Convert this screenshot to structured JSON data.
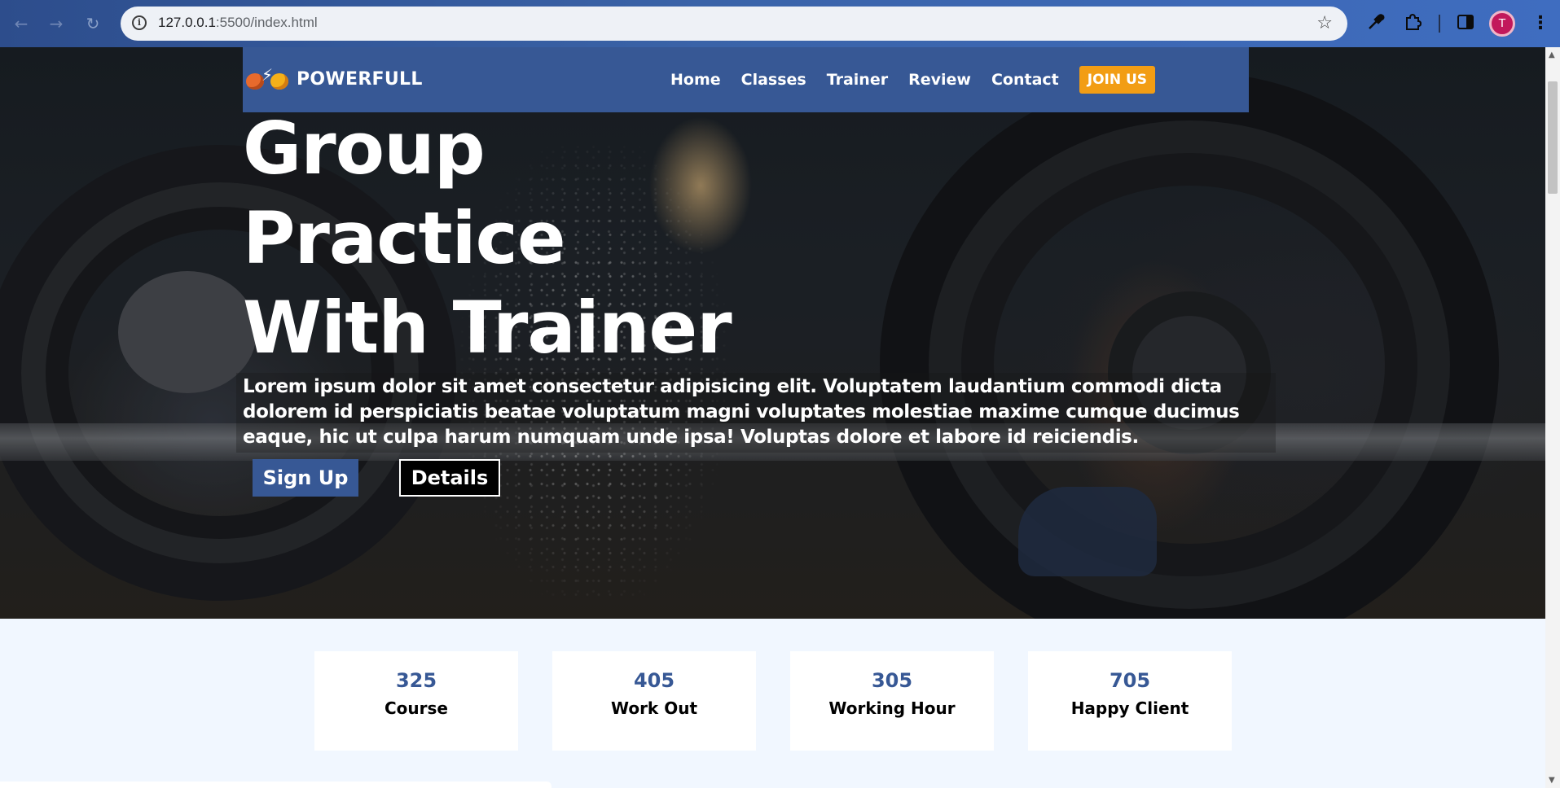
{
  "browser": {
    "url_host": "127.0.0.1",
    "url_rest": ":5500/index.html",
    "back_icon": "arrow-left",
    "forward_icon": "arrow-right",
    "reload_icon": "reload",
    "info_icon": "i",
    "bookmark_icon": "☆",
    "profile_initial": "T"
  },
  "site": {
    "logo_text": "POWERFULL",
    "nav": {
      "home": "Home",
      "classes": "Classes",
      "trainer": "Trainer",
      "review": "Review",
      "contact": "Contact",
      "join": "JOIN US"
    },
    "hero": {
      "title_line1": "Group",
      "title_line2": "Practice",
      "title_line3": "With Trainer",
      "text": "Lorem ipsum dolor sit amet consectetur adipisicing elit. Voluptatem laudantium commodi dicta dolorem id perspiciatis beatae voluptatum magni voluptates molestiae maxime cumque ducimus eaque, hic ut culpa harum numquam unde ipsa! Voluptas dolore et labore id reiciendis.",
      "signup": "Sign Up",
      "details": "Details"
    },
    "stats": [
      {
        "value": "325",
        "label": "Course"
      },
      {
        "value": "405",
        "label": "Work Out"
      },
      {
        "value": "305",
        "label": "Working Hour"
      },
      {
        "value": "705",
        "label": "Happy Client"
      }
    ]
  },
  "colors": {
    "brand_blue": "#375895",
    "accent_orange": "#f29d14",
    "stats_bg": "#f1f7ff"
  }
}
